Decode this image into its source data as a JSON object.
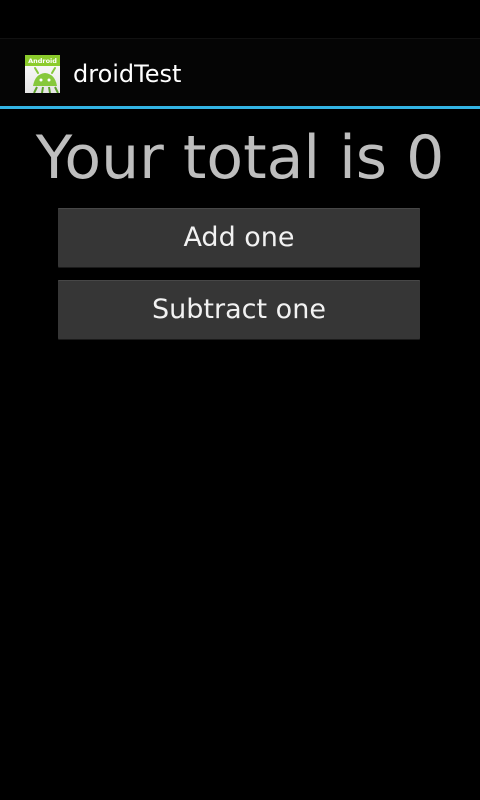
{
  "app": {
    "title": "droidTest",
    "icon": "android-app-icon",
    "icon_text": "Android",
    "accent_color": "#33b5e5"
  },
  "main": {
    "total_text": "Your total is 0",
    "buttons": {
      "add_label": "Add one",
      "subtract_label": "Subtract one"
    }
  }
}
